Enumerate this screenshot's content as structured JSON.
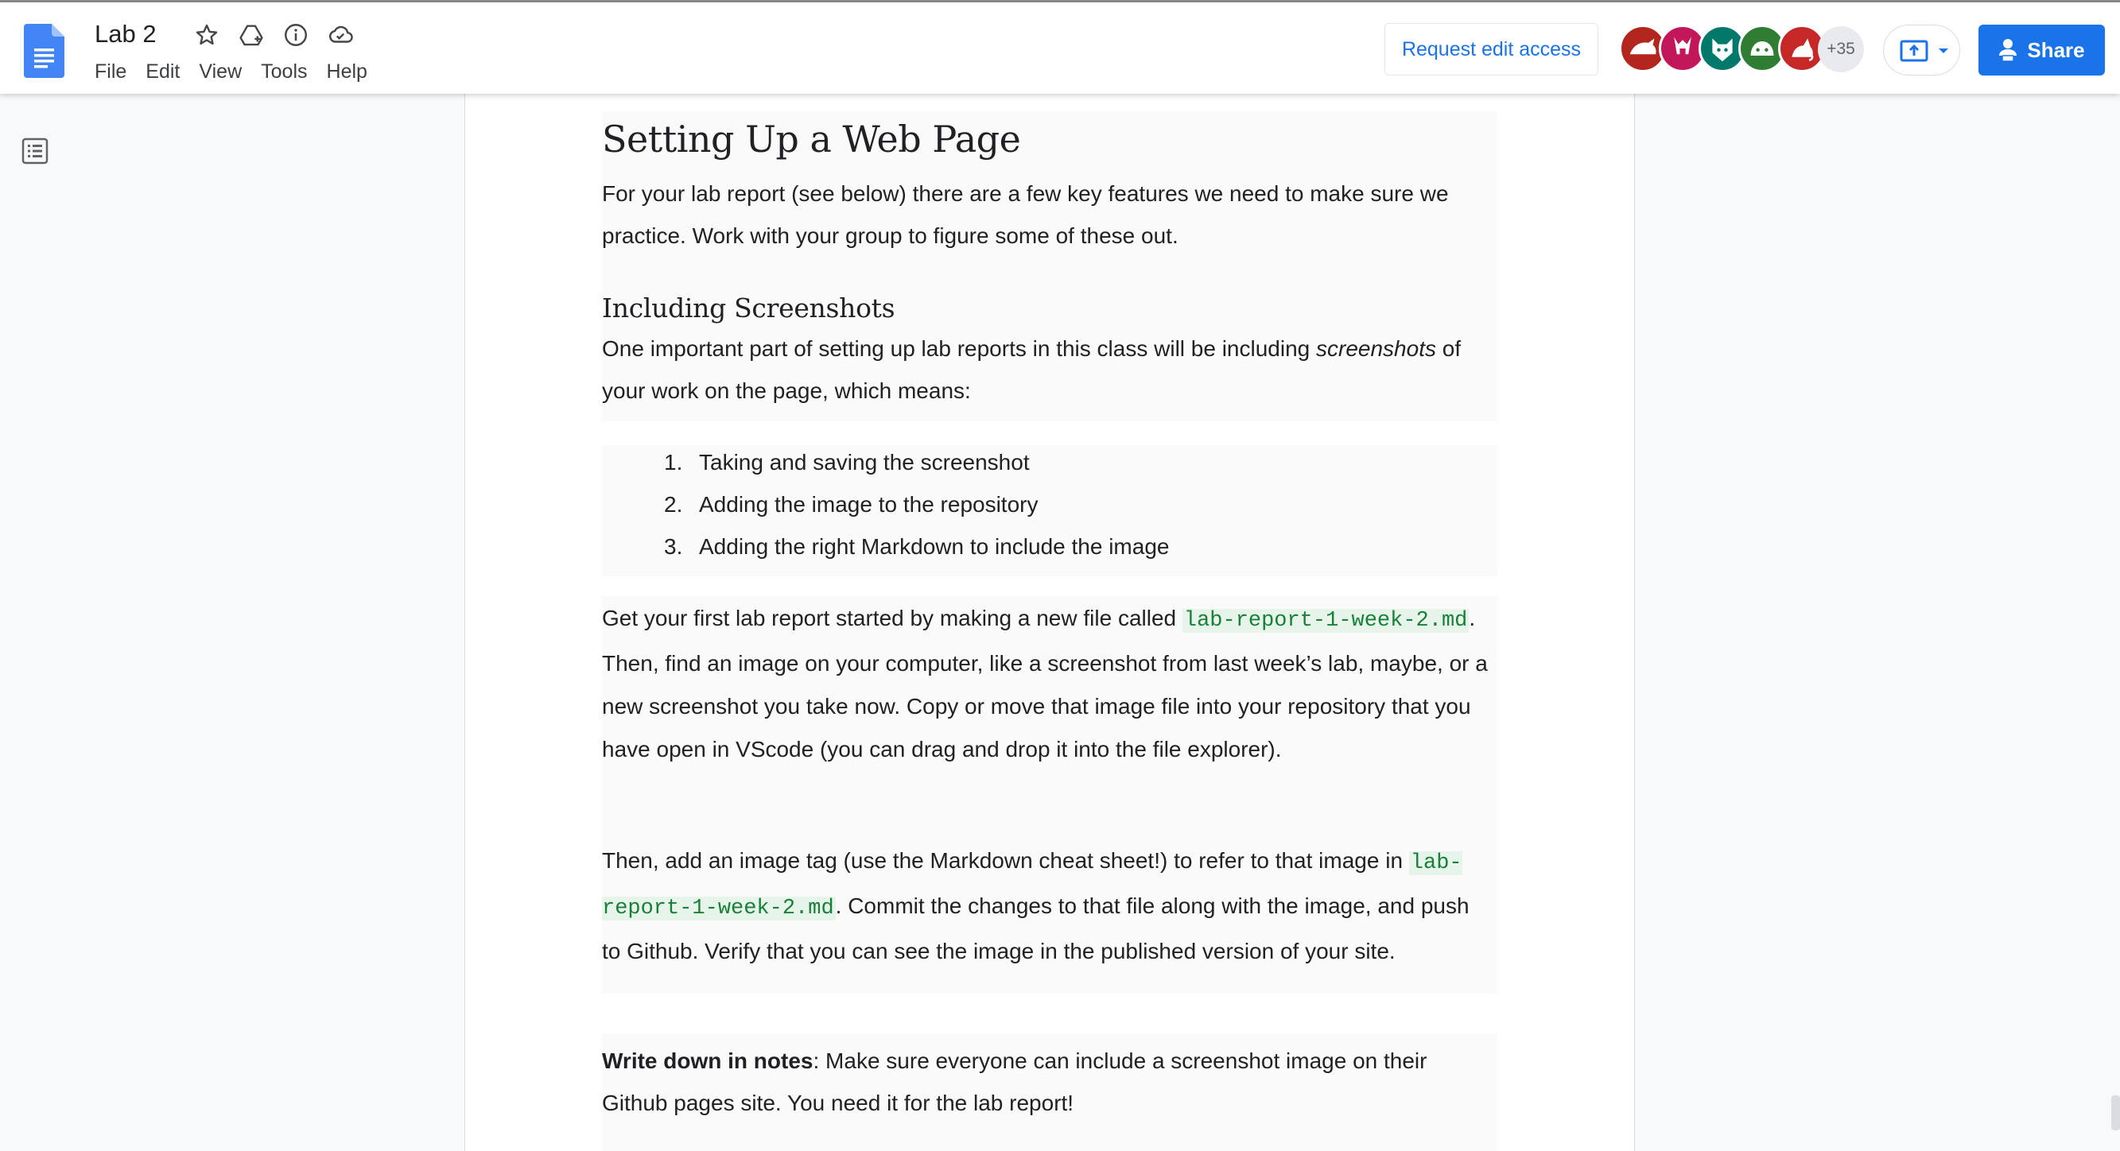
{
  "app": {
    "doc_title": "Lab 2",
    "menu": [
      "File",
      "Edit",
      "View",
      "Tools",
      "Help"
    ],
    "title_icons": [
      "star-icon",
      "move-to-drive-icon",
      "info-icon",
      "cloud-saved-icon"
    ]
  },
  "header": {
    "request_edit_label": "Request edit access",
    "collaborators_more": "+35",
    "share_label": "Share",
    "avatar_colors": [
      "#b3261e",
      "#c2185b",
      "#00796b",
      "#2e7d32",
      "#c62828"
    ]
  },
  "document": {
    "heading1": "Setting Up a Web Page",
    "intro_p": "For your lab report (see below) there are a few key features we need to make sure we practice. Work with your group to figure some of these out.",
    "heading2": "Including Screenshots",
    "screens_p_pre": "One important part of setting up lab reports in this class will be including ",
    "screens_p_em": "screenshots",
    "screens_p_post": " of your work on the page, which means:",
    "list": [
      {
        "num": "1.",
        "text": "Taking and saving the screenshot"
      },
      {
        "num": "2.",
        "text": "Adding the image to the repository"
      },
      {
        "num": "3.",
        "text": "Adding the right Markdown to include the image"
      }
    ],
    "p3_pre": "Get your first lab report started by making a new file called ",
    "filename": "lab-report-1-week-2.md",
    "p3_post": ". Then, find an image on your computer, like a screenshot from last week’s lab, maybe, or a new screenshot you take now. Copy or move that image file into your repository that you have open in VScode (you can drag and drop it into the file explorer).",
    "p4_pre": "Then, add an image tag (use the Markdown cheat sheet!) to refer to that image in ",
    "p4_post": ". Commit the changes to that file along with the image, and push to Github. Verify that you can see the image in the published version of your site.",
    "p5_bold": "Write down in notes",
    "p5_rest": ": Make sure everyone can include a screenshot image on their Github pages site. You need it for the lab report!"
  }
}
